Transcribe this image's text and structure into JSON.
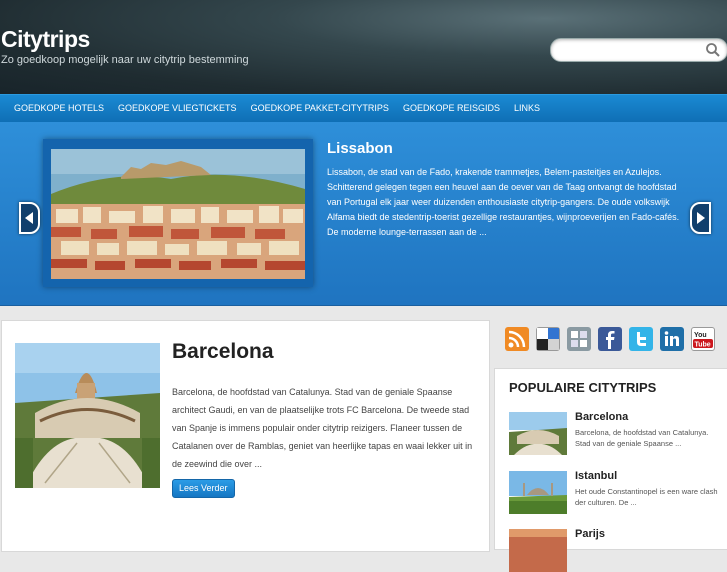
{
  "site": {
    "title": "Citytrips",
    "tagline": "Zo goedkoop mogelijk naar uw citytrip bestemming"
  },
  "search": {
    "placeholder": "",
    "value": ""
  },
  "nav": {
    "items": [
      {
        "label": "Goedkope Hotels"
      },
      {
        "label": "Goedkope Vliegtickets"
      },
      {
        "label": "Goedkope Pakket-Citytrips"
      },
      {
        "label": "Goedkope Reisgids"
      },
      {
        "label": "Links"
      }
    ]
  },
  "slider": {
    "title": "Lissabon",
    "text": "Lissabon, de stad van de Fado, krakende trammetjes, Belem-pasteitjes en Azulejos. Schitterend gelegen tegen een heuvel aan de oever van de Taag ontvangt de hoofdstad van Portugal elk jaar weer duizenden enthousiaste citytrip-gangers. De oude volkswijk Alfama biedt de stedentrip-toerist gezellige restaurantjes, wijnproeverijen en Fado-cafés. De moderne lounge-terrassen aan de ..."
  },
  "post": {
    "title": "Barcelona",
    "text": "Barcelona, de hoofdstad van Catalunya. Stad van de geniale Spaanse architect Gaudi, en van de plaatselijke trots FC Barcelona. De tweede stad van Spanje is immens populair onder citytrip reizigers. Flaneer tussen de Catalanen over de Ramblas, geniet van heerlijke tapas en waai lekker uit in de zeewind die over ...",
    "read_more": "Lees Verder"
  },
  "social": [
    "rss-icon",
    "delicious-icon",
    "stumbleupon-icon",
    "facebook-icon",
    "twitter-icon",
    "linkedin-icon",
    "youtube-icon"
  ],
  "sidebar": {
    "title": "Populaire Citytrips",
    "items": [
      {
        "title": "Barcelona",
        "text": "Barcelona, de hoofdstad van Catalunya. Stad van de geniale Spaanse ..."
      },
      {
        "title": "Istanbul",
        "text": "Het oude Constantinopel is een ware clash der culturen. De ..."
      },
      {
        "title": "Parijs",
        "text": ""
      }
    ]
  },
  "colors": {
    "nav": "#1a8ad3",
    "slider": "#2e8fd9",
    "header": "#34474d"
  }
}
